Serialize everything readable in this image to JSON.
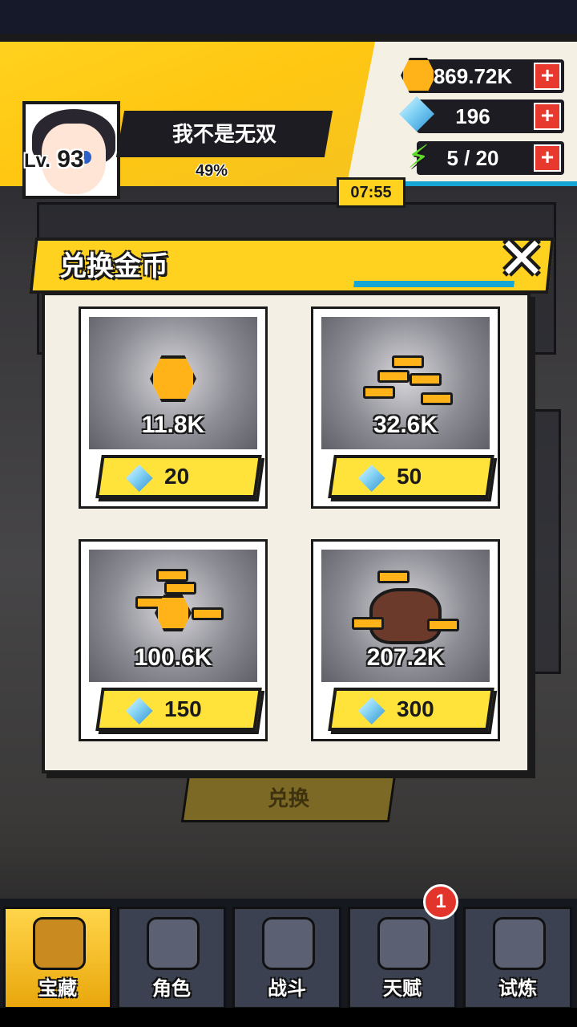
{
  "player": {
    "name": "我不是无双",
    "level_prefix": "Lv.",
    "level": "93",
    "exp_percent": "49%"
  },
  "resources": {
    "gold": "869.72K",
    "gems": "196",
    "energy_timer": "07:55",
    "energy": "5 / 20",
    "plus_symbol": "+"
  },
  "background": {
    "exchange_button_label": "兑换"
  },
  "modal": {
    "title": "兑换金币",
    "close_symbol": "✕",
    "offers": [
      {
        "amount": "11.8K",
        "price": "20"
      },
      {
        "amount": "32.6K",
        "price": "50"
      },
      {
        "amount": "100.6K",
        "price": "150"
      },
      {
        "amount": "207.2K",
        "price": "300"
      }
    ]
  },
  "bottom_nav": {
    "items": [
      {
        "label": "宝藏",
        "icon": "treasure-chest-icon",
        "active": true
      },
      {
        "label": "角色",
        "icon": "character-icon",
        "active": false
      },
      {
        "label": "战斗",
        "icon": "sword-icon",
        "active": false
      },
      {
        "label": "天赋",
        "icon": "lightbulb-icon",
        "active": false
      },
      {
        "label": "试炼",
        "icon": "trial-emblem-icon",
        "active": false
      }
    ],
    "talent_badge": "1"
  },
  "colors": {
    "accent_yellow": "#ffd21f",
    "accent_blue": "#16a6d6",
    "plus_red": "#e8392f"
  }
}
